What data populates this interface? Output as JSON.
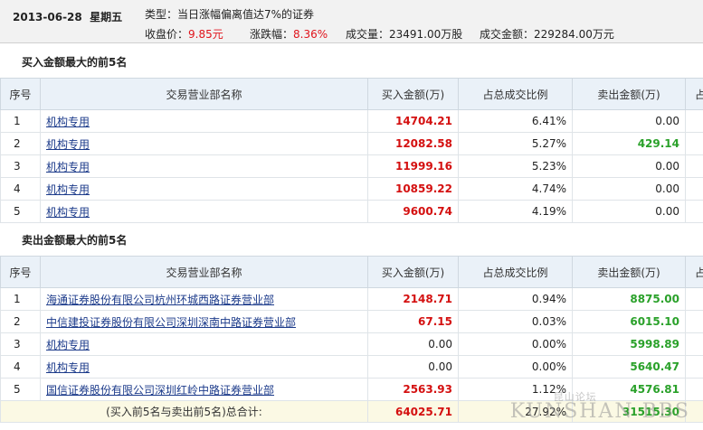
{
  "header": {
    "date": "2013-06-28",
    "weekday": "星期五",
    "type": "类型：当日涨幅偏离值达7%的证券",
    "close_label": "收盘价：",
    "close_value": "9.85元",
    "change_label": "涨跌幅：",
    "change_value": "8.36%",
    "volume": "成交量：23491.00万股",
    "amount": "成交金额：229284.00万元"
  },
  "colors": {
    "up": "#e0141c",
    "down": "#2aa12a",
    "link": "#1b3a8a",
    "header_bg": "#eaf1f8"
  },
  "buy_section": {
    "title": "买入金额最大的前5名",
    "columns": [
      "序号",
      "交易营业部名称",
      "买入金额(万)",
      "占总成交比例",
      "卖出金额(万)",
      "占"
    ],
    "rows": [
      {
        "idx": "1",
        "name": "机构专用",
        "buy": "14704.21",
        "ratio": "6.41%",
        "sell": "0.00",
        "sell_color": "black"
      },
      {
        "idx": "2",
        "name": "机构专用",
        "buy": "12082.58",
        "ratio": "5.27%",
        "sell": "429.14",
        "sell_color": "green"
      },
      {
        "idx": "3",
        "name": "机构专用",
        "buy": "11999.16",
        "ratio": "5.23%",
        "sell": "0.00",
        "sell_color": "black"
      },
      {
        "idx": "4",
        "name": "机构专用",
        "buy": "10859.22",
        "ratio": "4.74%",
        "sell": "0.00",
        "sell_color": "black"
      },
      {
        "idx": "5",
        "name": "机构专用",
        "buy": "9600.74",
        "ratio": "4.19%",
        "sell": "0.00",
        "sell_color": "black"
      }
    ]
  },
  "sell_section": {
    "title": "卖出金额最大的前5名",
    "columns": [
      "序号",
      "交易营业部名称",
      "买入金额(万)",
      "占总成交比例",
      "卖出金额(万)",
      "占"
    ],
    "rows": [
      {
        "idx": "1",
        "name": "海通证券股份有限公司杭州环城西路证券营业部",
        "buy": "2148.71",
        "buy_color": "red",
        "ratio": "0.94%",
        "sell": "8875.00"
      },
      {
        "idx": "2",
        "name": "中信建投证券股份有限公司深圳深南中路证券营业部",
        "buy": "67.15",
        "buy_color": "red",
        "ratio": "0.03%",
        "sell": "6015.10"
      },
      {
        "idx": "3",
        "name": "机构专用",
        "buy": "0.00",
        "buy_color": "black",
        "ratio": "0.00%",
        "sell": "5998.89"
      },
      {
        "idx": "4",
        "name": "机构专用",
        "buy": "0.00",
        "buy_color": "black",
        "ratio": "0.00%",
        "sell": "5640.47"
      },
      {
        "idx": "5",
        "name": "国信证券股份有限公司深圳红岭中路证券营业部",
        "buy": "2563.93",
        "buy_color": "red",
        "ratio": "1.12%",
        "sell": "4576.81"
      }
    ],
    "total": {
      "label_normal": "(买入前5名与卖出前5名)",
      "label_bold": "总合计:",
      "buy": "64025.71",
      "ratio": "27.92%",
      "sell": "31515.30"
    }
  },
  "watermark": {
    "latin": "KUNSHAN BBS",
    "cn": "昆山论坛"
  }
}
